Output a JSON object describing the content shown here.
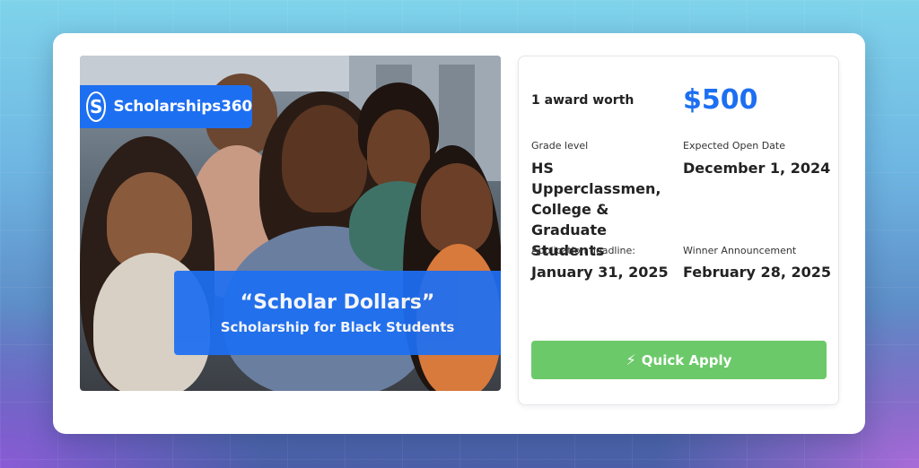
{
  "brand": {
    "logo_letter": "S",
    "name": "Scholarships360",
    "color": "#1d6ff2"
  },
  "banner": {
    "title": "“Scholar Dollars”",
    "subtitle": "Scholarship for Black Students"
  },
  "award": {
    "label": "1 award worth",
    "amount": "$500"
  },
  "details": {
    "grade_level_label": "Grade level",
    "grade_level_value": "HS Upperclassmen, College & Graduate Students",
    "open_date_label": "Expected Open Date",
    "open_date_value": "December 1, 2024",
    "deadline_label": "Application deadline:",
    "deadline_value": "January 31, 2025",
    "winner_label": "Winner Announcement",
    "winner_value": "February 28, 2025"
  },
  "apply_button": {
    "icon": "lightning-bolt-icon",
    "label": "Quick Apply",
    "color": "#6cc96a"
  }
}
